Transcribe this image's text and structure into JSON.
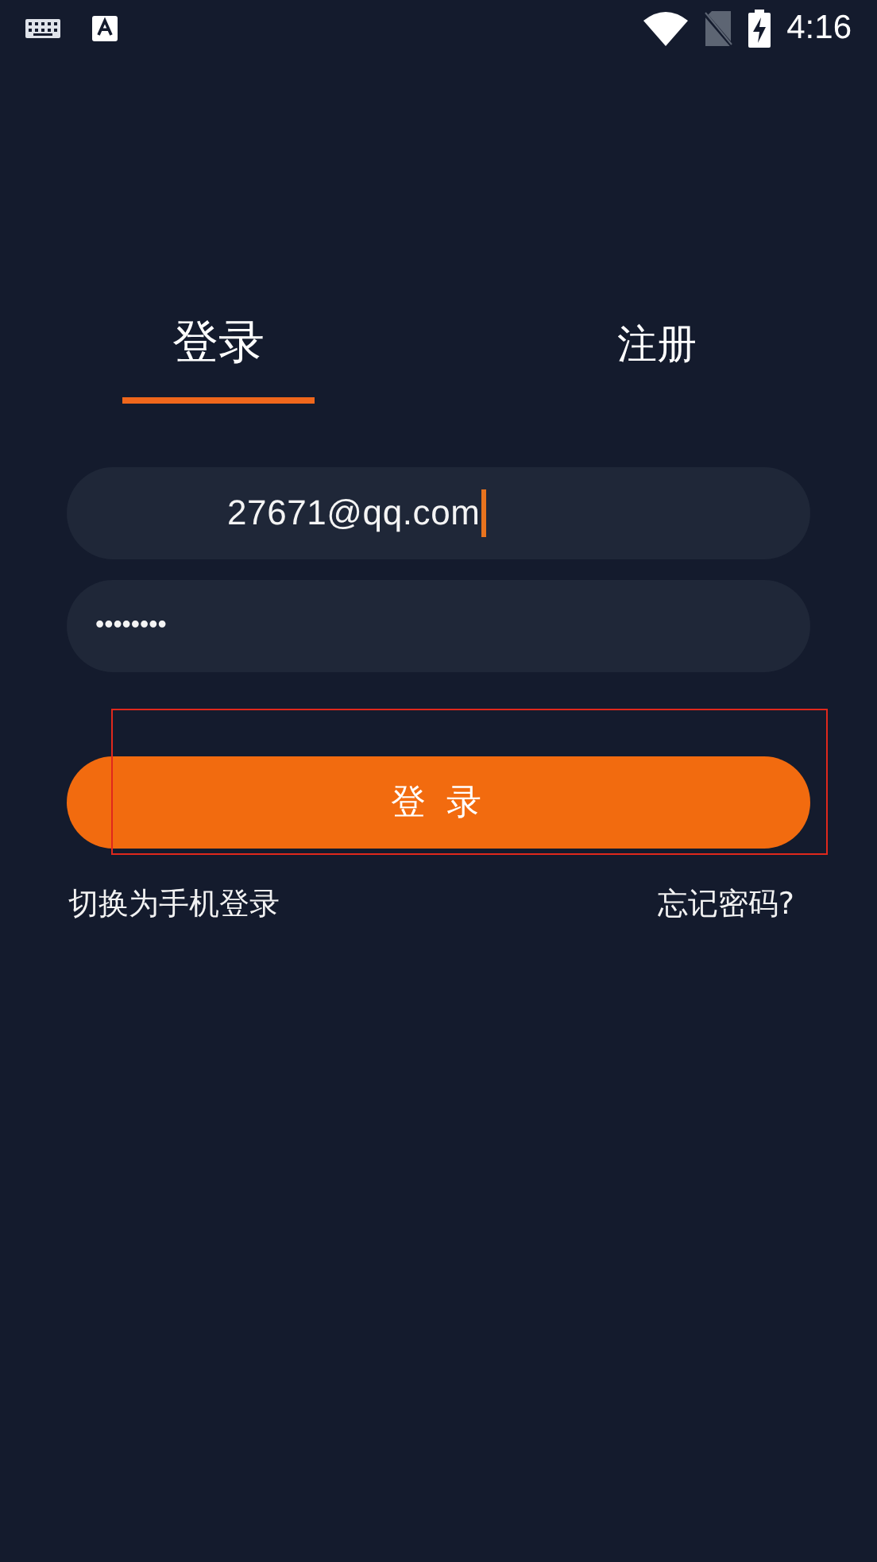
{
  "status_bar": {
    "time": "4:16"
  },
  "tabs": [
    {
      "label": "登录",
      "selected": true
    },
    {
      "label": "注册",
      "selected": false
    }
  ],
  "fields": [
    {
      "kind": "text",
      "value": "27671@qq.com",
      "focused": true
    },
    {
      "kind": "password",
      "value": "••••••••",
      "focused": false
    }
  ],
  "login_button": {
    "label": "登 录",
    "highlighted": true
  },
  "links": [
    {
      "label": "切换为手机登录"
    },
    {
      "label": "忘记密码?"
    }
  ]
}
